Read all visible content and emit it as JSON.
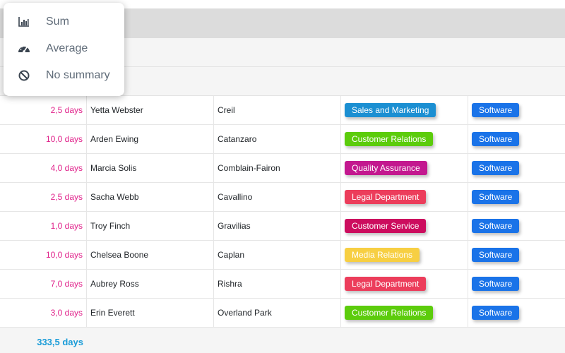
{
  "summary_menu": {
    "items": [
      {
        "label": "Sum",
        "icon": "bar-chart-icon"
      },
      {
        "label": "Average",
        "icon": "gauge-icon"
      },
      {
        "label": "No summary",
        "icon": "ban-icon"
      }
    ]
  },
  "colors": {
    "days_text": "#e0218a",
    "total_text": "#1a9cd8",
    "tag_software": "#1a73e8",
    "dept": {
      "Sales and Marketing": "#1b8fd2",
      "Customer Relations": "#5ccc0c",
      "Quality Assurance": "#c3188f",
      "Legal Department": "#ec3d5b",
      "Customer Service": "#cc0d5e",
      "Media Relations": "#f7cf43"
    }
  },
  "rows": [
    {
      "days": "2,5 days",
      "name": "Yetta Webster",
      "city": "Creil",
      "department": "Sales and Marketing",
      "category": "Software"
    },
    {
      "days": "10,0 days",
      "name": "Arden Ewing",
      "city": "Catanzaro",
      "department": "Customer Relations",
      "category": "Software"
    },
    {
      "days": "4,0 days",
      "name": "Marcia Solis",
      "city": "Comblain-Fairon",
      "department": "Quality Assurance",
      "category": "Software"
    },
    {
      "days": "2,5 days",
      "name": "Sacha Webb",
      "city": "Cavallino",
      "department": "Legal Department",
      "category": "Software"
    },
    {
      "days": "1,0 days",
      "name": "Troy Finch",
      "city": "Gravilias",
      "department": "Customer Service",
      "category": "Software"
    },
    {
      "days": "10,0 days",
      "name": "Chelsea Boone",
      "city": "Caplan",
      "department": "Media Relations",
      "category": "Software"
    },
    {
      "days": "7,0 days",
      "name": "Aubrey Ross",
      "city": "Rishra",
      "department": "Legal Department",
      "category": "Software"
    },
    {
      "days": "3,0 days",
      "name": "Erin Everett",
      "city": "Overland Park",
      "department": "Customer Relations",
      "category": "Software"
    }
  ],
  "footer": {
    "total": "333,5 days"
  }
}
